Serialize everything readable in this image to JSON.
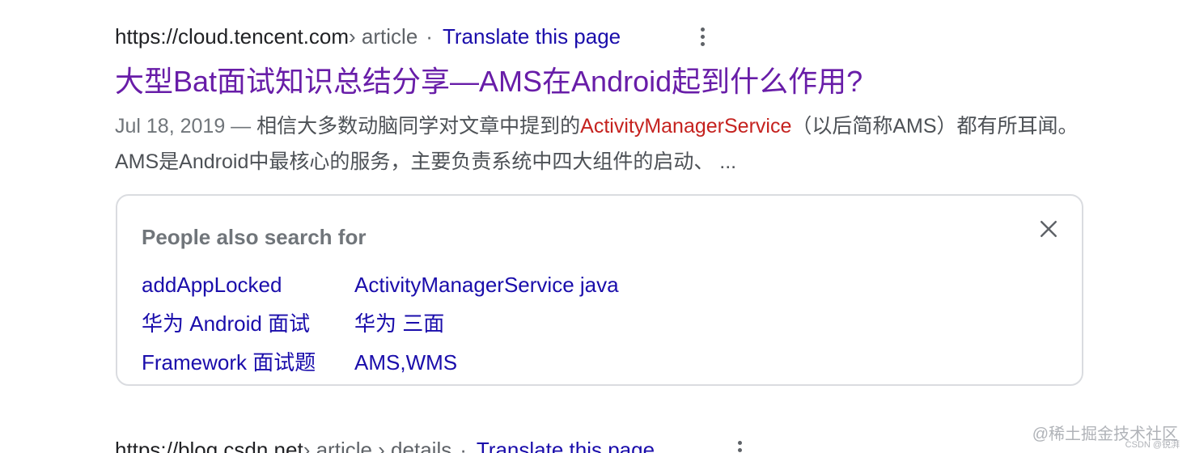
{
  "result1": {
    "cite_domain": "https://cloud.tencent.com",
    "cite_path": " › article",
    "separator": "·",
    "translate_label": "Translate this page",
    "more_icon": "more-vert-icon",
    "title": "大型Bat面试知识总结分享—AMS在Android起到什么作用?",
    "snippet_date": "Jul 18, 2019 — ",
    "snippet_text_1": "相信大多数动脑同学对文章中提到的",
    "snippet_highlight": "ActivityManagerService",
    "snippet_text_2": "（以后简称AMS）都有所耳闻。 AMS是Android中最核心的服务，主要负责系统中四大组件的启动、 ..."
  },
  "people_also_search": {
    "heading": "People also search for",
    "close_icon": "close-icon",
    "column1": [
      "addAppLocked",
      "华为 Android 面试",
      "Framework 面试题"
    ],
    "column2": [
      "ActivityManagerService java",
      "华为 三面",
      "AMS,WMS"
    ]
  },
  "result2": {
    "cite_domain": "https://blog.csdn.net",
    "cite_path": " › article › details",
    "separator": "·",
    "translate_label": "Translate this page",
    "more_icon": "more-vert-icon"
  },
  "watermark": {
    "main": "@稀土掘金技术社区",
    "sub": "CSDN @锐湃"
  },
  "colors": {
    "link": "#1a0dab",
    "visited_title": "#681da8",
    "highlight": "#c5221f",
    "secondary_text": "#70757a"
  }
}
